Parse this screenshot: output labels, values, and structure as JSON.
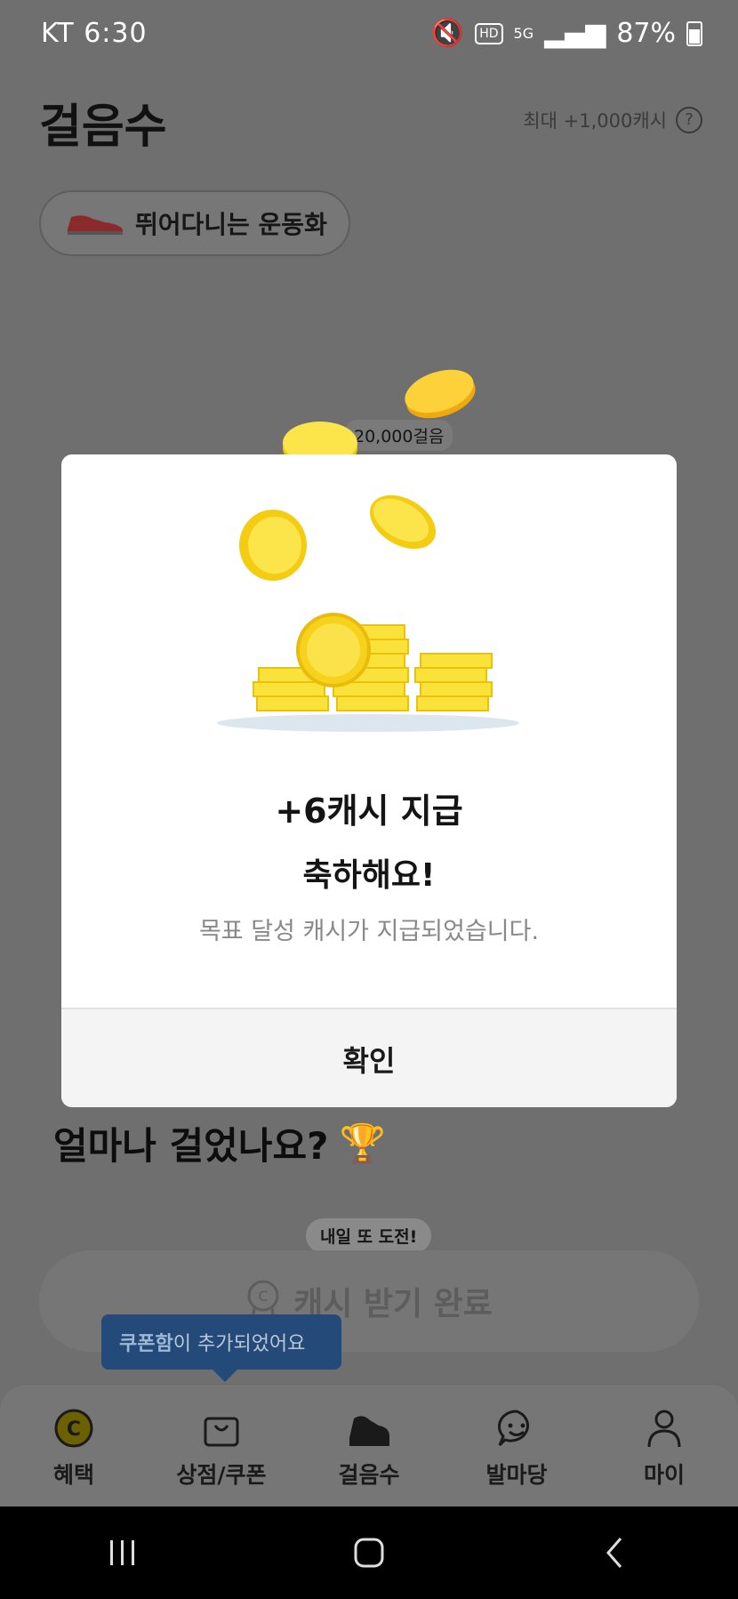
{
  "status_bar": {
    "carrier_time": "KT 6:30",
    "network_label": "5G",
    "hd_label": "HD",
    "battery": "87%"
  },
  "header": {
    "title": "걸음수",
    "max_cash": "최대 +1,000캐시",
    "help_icon": "question-icon"
  },
  "shoe_chip": {
    "label": "뛰어다니는 운동화"
  },
  "goal": {
    "label": "20,000걸음"
  },
  "section": {
    "title": "얼마나 걸었나요?",
    "trophy": "🏆"
  },
  "cash_button": {
    "label": "캐시 받기 완료",
    "bubble": "내일 또 도전!"
  },
  "toast": {
    "highlight": "쿠폰함",
    "rest": "이 추가되었어요"
  },
  "modal": {
    "title": "+6캐시 지급",
    "subtitle": "축하해요!",
    "description": "목표 달성 캐시가 지급되었습니다.",
    "confirm": "확인"
  },
  "bottom_nav": {
    "items": [
      {
        "label": "혜택",
        "icon": "cash-coin-icon"
      },
      {
        "label": "상점/쿠폰",
        "icon": "shopping-bag-icon"
      },
      {
        "label": "걸음수",
        "icon": "sneaker-icon"
      },
      {
        "label": "발마당",
        "icon": "chat-smile-icon"
      },
      {
        "label": "마이",
        "icon": "person-icon"
      }
    ]
  },
  "colors": {
    "accent_yellow": "#f5d50f",
    "toast_blue": "#234a78"
  }
}
